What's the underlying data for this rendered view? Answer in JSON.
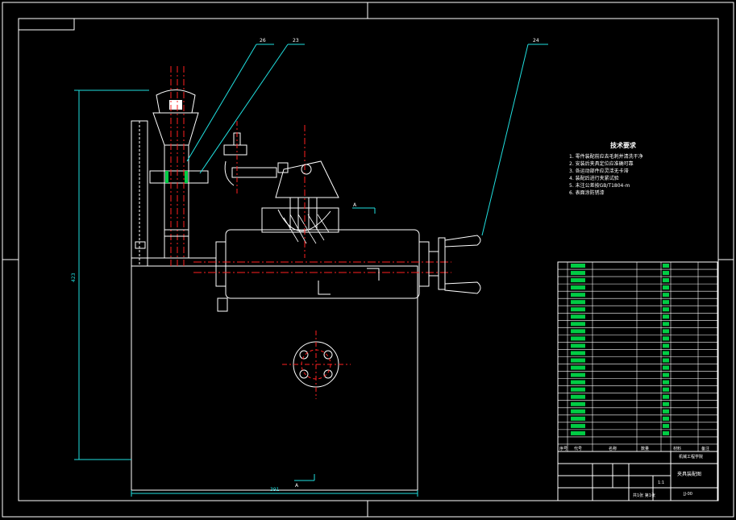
{
  "drawing": {
    "colors": {
      "background": "#000000",
      "outline": "#ffffff",
      "centerline": "#ff2020",
      "leader": "#20e0e0",
      "dimension": "#20e0e0",
      "part_fill": "#00cc44",
      "hatch": "#ffffff"
    },
    "balloons": [
      "26",
      "23",
      "24"
    ],
    "section_mark": "A",
    "section_mark_bottom": "A",
    "dim_height": "423",
    "dim_width": "391",
    "tech_requirements": {
      "title": "技术要求",
      "items": [
        "1. 零件装配前应去毛刺并清洗干净",
        "2. 安装后夹具定位应准确可靠",
        "3. 各运动部件应灵活无卡滞",
        "4. 装配后进行夹紧试验",
        "5. 未注公差按GB/T1804-m",
        "6. 表面涂防锈漆"
      ]
    },
    "parts_table": {
      "footer_labels": [
        "序号",
        "代号",
        "名称",
        "数量",
        "材料",
        "备注"
      ]
    },
    "title_block": {
      "school": "机械工程学院",
      "drawing_name": "夹具装配图",
      "scale": "1:1",
      "sheet": "共1张 第1张",
      "code": "JJ-00"
    }
  }
}
